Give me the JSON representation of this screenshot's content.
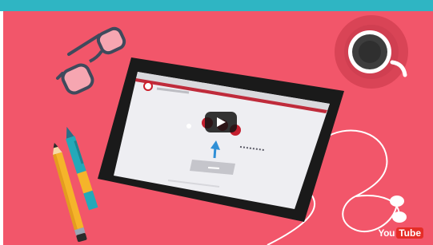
{
  "video": {
    "platform_logo": {
      "you": "You",
      "tube": "Tube"
    },
    "play_icon": "play-icon",
    "colors": {
      "background": "#f2566a",
      "top_bar": "#2fb5c3",
      "tablet": "#1a1a1a",
      "glasses_frame": "#3f4a5c",
      "mug_plate": "#d94456",
      "pencil_yellow": "#f5b42a",
      "pen_teal": "#23a9b9",
      "youtube_red": "#e52d27"
    }
  }
}
